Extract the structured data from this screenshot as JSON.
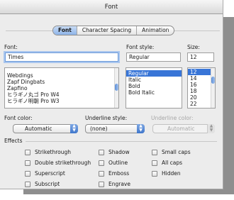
{
  "window": {
    "title": "Font"
  },
  "tabs": [
    {
      "label": "Font",
      "active": true
    },
    {
      "label": "Character Spacing",
      "active": false
    },
    {
      "label": "Animation",
      "active": false
    }
  ],
  "font": {
    "label": "Font:",
    "value": "Times",
    "items": [
      "Webdings",
      "Zapf Dingbats",
      "Zapfino",
      "ヒラギノ丸ゴ Pro W4",
      "ヒラギノ明朝 Pro W3"
    ]
  },
  "font_style": {
    "label": "Font style:",
    "value": "Regular",
    "items": [
      "Regular",
      "Italic",
      "Bold",
      "Bold Italic"
    ],
    "selected": "Regular"
  },
  "size": {
    "label": "Size:",
    "value": "12",
    "items": [
      "12",
      "14",
      "16",
      "18",
      "20",
      "22"
    ],
    "selected": "12"
  },
  "font_color": {
    "label": "Font color:",
    "value": "Automatic"
  },
  "underline_style": {
    "label": "Underline style:",
    "value": "(none)"
  },
  "underline_color": {
    "label": "Underline color:",
    "value": "Automatic",
    "disabled": true
  },
  "effects": {
    "label": "Effects",
    "items": {
      "strikethrough": "Strikethrough",
      "double_strikethrough": "Double strikethrough",
      "superscript": "Superscript",
      "subscript": "Subscript",
      "shadow": "Shadow",
      "outline": "Outline",
      "emboss": "Emboss",
      "engrave": "Engrave",
      "small_caps": "Small caps",
      "all_caps": "All caps",
      "hidden": "Hidden"
    }
  },
  "colors": {
    "selection": "#3875d7",
    "accent": "#8eb4e9",
    "focus_ring": "#a9c6ee"
  }
}
